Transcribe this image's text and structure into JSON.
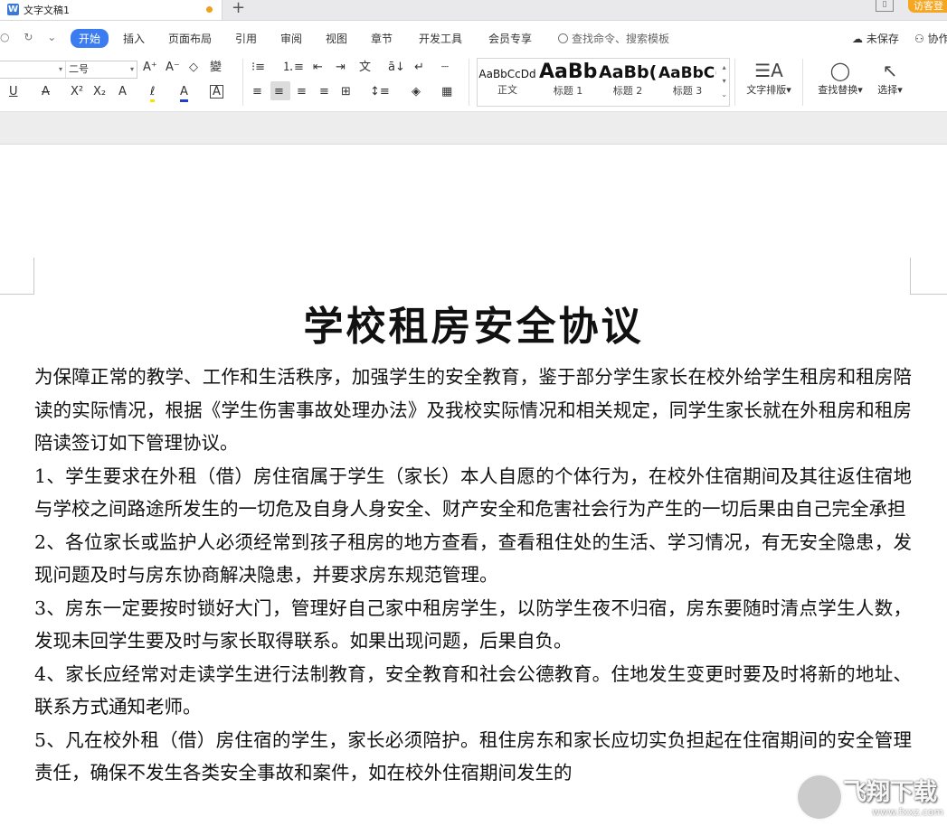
{
  "window": {
    "doc_tab_label": "文字文稿1",
    "doc_icon_letter": "W",
    "new_tab_symbol": "+",
    "visitor_button": "访客登"
  },
  "menu": {
    "quick": [
      "○",
      "↻",
      "⌄"
    ],
    "items": [
      "开始",
      "插入",
      "页面布局",
      "引用",
      "审阅",
      "视图",
      "章节",
      "开发工具",
      "会员专享"
    ],
    "search_placeholder": "查找命令、搜索模板",
    "unsaved": "未保存",
    "collab": "协作"
  },
  "ribbon": {
    "font_size": "二号",
    "style_samples": [
      {
        "sample": "AaBbCcDd",
        "caption": "正文"
      },
      {
        "sample": "AaBb",
        "caption": "标题 1"
      },
      {
        "sample": "AaBb(",
        "caption": "标题 2"
      },
      {
        "sample": "AaBbC(",
        "caption": "标题 3"
      }
    ],
    "tools": {
      "layout": "文字排版",
      "find_replace": "查找替换",
      "select": "选择"
    },
    "glyphs": {
      "grow": "A⁺",
      "shrink": "A⁻",
      "clear": "◇",
      "phonetic": "變",
      "underline": "U",
      "strike": "A",
      "sup": "X²",
      "sub": "X₂",
      "effect": "A",
      "highlight": "ℓ",
      "color": "A",
      "border": "A",
      "bullets": "⁝≡",
      "numbered": "⒈≡",
      "outdent": "⇤",
      "indent": "⇥",
      "chinese": "文",
      "sort": "ā↓",
      "linebreak": "↵",
      "grid": "┈",
      "al_left": "≡",
      "al_center": "≡",
      "al_right": "≡",
      "al_justify": "≡",
      "al_dist": "⊞",
      "spacing": "↕≡",
      "shade": "◈",
      "borders": "▦",
      "find_icon": "◯",
      "select_icon": "↖",
      "layout_icon": "☰A"
    }
  },
  "document": {
    "title": "学校租房安全协议",
    "paragraphs": [
      "为保障正常的教学、工作和生活秩序，加强学生的安全教育，鉴于部分学生家长在校外给学生租房和租房陪读的实际情况，根据《学生伤害事故处理办法》及我校实际情况和相关规定，同学生家长就在外租房和租房陪读签订如下管理协议。",
      "1、学生要求在外租（借）房住宿属于学生（家长）本人自愿的个体行为，在校外住宿期间及其往返住宿地与学校之间路途所发生的一切危及自身人身安全、财产安全和危害社会行为产生的一切后果由自己完全承担",
      "2、各位家长或监护人必须经常到孩子租房的地方查看，查看租住处的生活、学习情况，有无安全隐患，发现问题及时与房东协商解决隐患，并要求房东规范管理。",
      "3、房东一定要按时锁好大门，管理好自己家中租房学生，以防学生夜不归宿，房东要随时清点学生人数，发现未回学生要及时与家长取得联系。如果出现问题，后果自负。",
      "4、家长应经常对走读学生进行法制教育，安全教育和社会公德教育。住地发生变更时要及时将新的地址、联系方式通知老师。",
      "5、凡在校外租（借）房住宿的学生，家长必须陪护。租住房东和家长应切实负担起在住宿期间的安全管理责任，确保不发生各类安全事故和案件，如在校外住宿期间发生的"
    ]
  },
  "watermark": {
    "logo_text": "飞翔下载",
    "site": "www.fxxz.com"
  }
}
